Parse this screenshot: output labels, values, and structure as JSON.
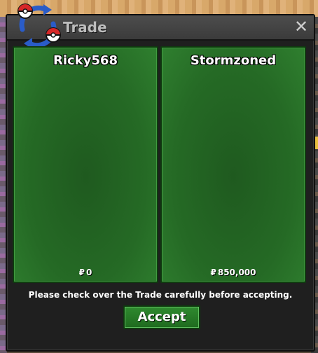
{
  "window": {
    "title": "Trade",
    "close_label": "✕"
  },
  "panels": [
    {
      "player": "Ricky568",
      "money_symbol": "₽",
      "money": "0"
    },
    {
      "player": "Stormzoned",
      "money_symbol": "₽",
      "money": "850,000"
    }
  ],
  "notice": "Please check over the Trade carefully before accepting.",
  "accept_label": "Accept",
  "icons": {
    "trade": "trade-arrows-pokeball-icon",
    "close": "close-icon",
    "money": "pokedollar-icon"
  },
  "colors": {
    "panel_green": "#256a25",
    "accept_green": "#2f8a2f",
    "window_bg": "#1f1f1f",
    "title_text": "#bdbdbd"
  }
}
